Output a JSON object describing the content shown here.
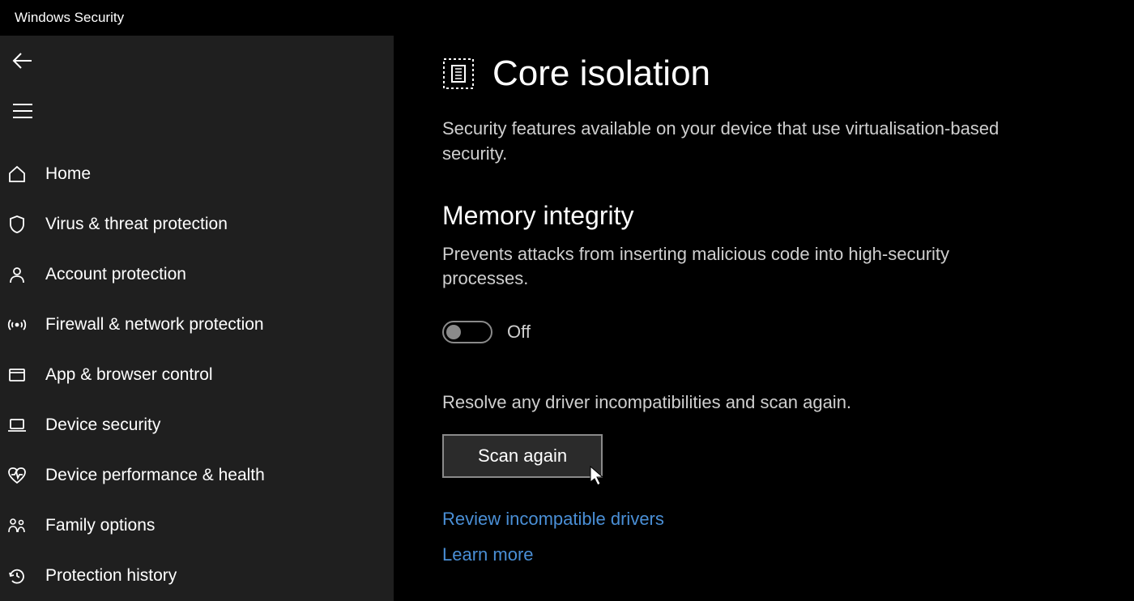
{
  "app_title": "Windows Security",
  "sidebar": {
    "items": [
      {
        "label": "Home"
      },
      {
        "label": "Virus & threat protection"
      },
      {
        "label": "Account protection"
      },
      {
        "label": "Firewall & network protection"
      },
      {
        "label": "App & browser control"
      },
      {
        "label": "Device security"
      },
      {
        "label": "Device performance & health"
      },
      {
        "label": "Family options"
      },
      {
        "label": "Protection history"
      }
    ]
  },
  "main": {
    "title": "Core isolation",
    "subtitle": "Security features available on your device that use virtualisation-based security.",
    "section": {
      "title": "Memory integrity",
      "desc": "Prevents attacks from inserting malicious code into high-security processes.",
      "toggle_state": "Off",
      "info": "Resolve any driver incompatibilities and scan again.",
      "scan_button": "Scan again",
      "review_link": "Review incompatible drivers",
      "learn_link": "Learn more"
    }
  }
}
